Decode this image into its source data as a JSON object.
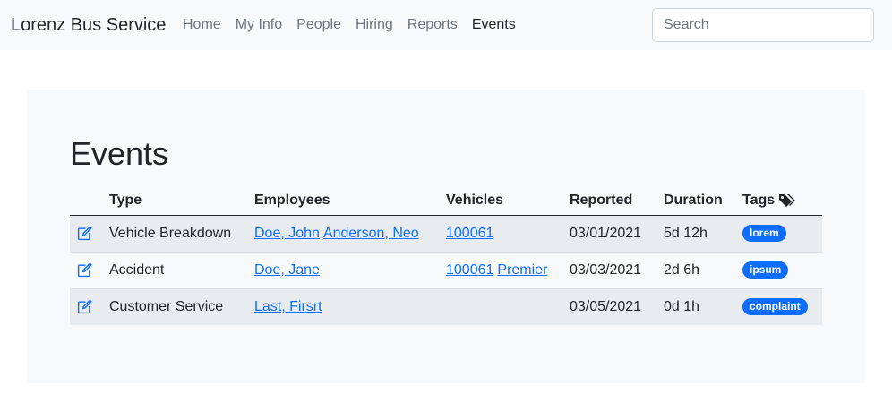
{
  "navbar": {
    "brand": "Lorenz Bus Service",
    "links": [
      "Home",
      "My Info",
      "People",
      "Hiring",
      "Reports",
      "Events"
    ],
    "active": "Events",
    "search_placeholder": "Search"
  },
  "colors": {
    "link": "#0d6efd",
    "badge": "#0d6efd",
    "navbar_bg": "#f8f9fa"
  },
  "page": {
    "title": "Events",
    "columns": [
      "Type",
      "Employees",
      "Vehicles",
      "Reported",
      "Duration",
      "Tags"
    ],
    "tags_icon": "tags-icon",
    "edit_icon": "edit-icon",
    "rows": [
      {
        "type": "Vehicle Breakdown",
        "employees": [
          "Doe, John",
          "Anderson, Neo"
        ],
        "vehicles": [
          "100061"
        ],
        "reported": "03/01/2021",
        "duration": "5d 12h",
        "tag": "lorem"
      },
      {
        "type": "Accident",
        "employees": [
          "Doe, Jane"
        ],
        "vehicles": [
          "100061",
          "Premier"
        ],
        "reported": "03/03/2021",
        "duration": "2d 6h",
        "tag": "ipsum"
      },
      {
        "type": "Customer Service",
        "employees": [
          "Last, Firsrt"
        ],
        "vehicles": [],
        "reported": "03/05/2021",
        "duration": "0d 1h",
        "tag": "complaint"
      }
    ]
  }
}
